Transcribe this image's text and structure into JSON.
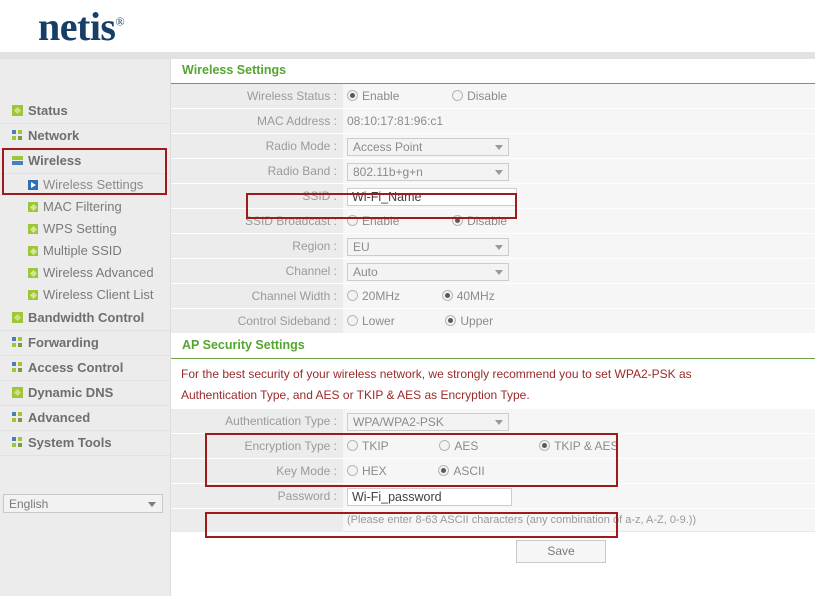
{
  "brand": {
    "name": "netis",
    "trademark": "®"
  },
  "sidebar": {
    "items": [
      {
        "label": "Status",
        "icon": "green-diamond-icon",
        "level": "top"
      },
      {
        "label": "Network",
        "icon": "grid-squares-icon",
        "level": "top"
      },
      {
        "label": "Wireless",
        "icon": "two-bars-icon",
        "level": "top"
      },
      {
        "label": "Wireless Settings",
        "icon": "play-arrow-icon",
        "level": "sub"
      },
      {
        "label": "MAC Filtering",
        "icon": "green-dot-icon",
        "level": "sub"
      },
      {
        "label": "WPS Setting",
        "icon": "green-dot-icon",
        "level": "sub"
      },
      {
        "label": "Multiple SSID",
        "icon": "green-dot-icon",
        "level": "sub"
      },
      {
        "label": "Wireless Advanced",
        "icon": "green-dot-icon",
        "level": "sub"
      },
      {
        "label": "Wireless Client List",
        "icon": "green-dot-icon",
        "level": "sub"
      },
      {
        "label": "Bandwidth Control",
        "icon": "green-diamond-icon",
        "level": "top"
      },
      {
        "label": "Forwarding",
        "icon": "grid-squares-icon",
        "level": "top"
      },
      {
        "label": "Access Control",
        "icon": "grid-squares-icon",
        "level": "top"
      },
      {
        "label": "Dynamic DNS",
        "icon": "green-diamond-icon",
        "level": "top"
      },
      {
        "label": "Advanced",
        "icon": "grid-squares-icon",
        "level": "top"
      },
      {
        "label": "System Tools",
        "icon": "grid-squares-icon",
        "level": "top"
      }
    ],
    "language": {
      "selected": "English",
      "icon": "chevron-down-icon"
    }
  },
  "main": {
    "wireless_section_title": "Wireless Settings",
    "security_section_title": "AP Security Settings",
    "rows": {
      "wireless_status": {
        "label": "Wireless Status :",
        "options": [
          {
            "label": "Enable",
            "selected": true
          },
          {
            "label": "Disable",
            "selected": false
          }
        ]
      },
      "mac_address": {
        "label": "MAC Address :",
        "value": "08:10:17:81:96:c1"
      },
      "radio_mode": {
        "label": "Radio Mode :",
        "value": "Access Point"
      },
      "radio_band": {
        "label": "Radio Band :",
        "value": "802.11b+g+n"
      },
      "ssid": {
        "label": "SSID :",
        "value": "Wi-Fi_Name"
      },
      "ssid_broadcast": {
        "label": "SSID Broadcast :",
        "options": [
          {
            "label": "Enable",
            "selected": false
          },
          {
            "label": "Disable",
            "selected": true
          }
        ]
      },
      "region": {
        "label": "Region :",
        "value": "EU"
      },
      "channel": {
        "label": "Channel :",
        "value": "Auto"
      },
      "channel_width": {
        "label": "Channel Width :",
        "options": [
          {
            "label": "20MHz",
            "selected": false
          },
          {
            "label": "40MHz",
            "selected": true
          }
        ]
      },
      "control_sideband": {
        "label": "Control Sideband :",
        "options": [
          {
            "label": "Lower",
            "selected": false
          },
          {
            "label": "Upper",
            "selected": true
          }
        ]
      },
      "auth_type": {
        "label": "Authentication Type :",
        "value": "WPA/WPA2-PSK"
      },
      "encryption_type": {
        "label": "Encryption Type :",
        "options": [
          {
            "label": "TKIP",
            "selected": false
          },
          {
            "label": "AES",
            "selected": false
          },
          {
            "label": "TKIP & AES",
            "selected": true
          }
        ]
      },
      "key_mode": {
        "label": "Key Mode :",
        "options": [
          {
            "label": "HEX",
            "selected": false
          },
          {
            "label": "ASCII",
            "selected": true
          }
        ]
      },
      "password": {
        "label": "Password :",
        "value": "Wi-Fi_password"
      }
    },
    "security_warning_line1": "For the best security of your wireless network, we strongly recommend you to set WPA2-PSK as",
    "security_warning_line2": "Authentication Type, and AES or TKIP & AES as Encryption Type.",
    "password_hint": "(Please enter 8-63 ASCII characters (any combination of a-z, A-Z, 0-9.))",
    "save_label": "Save"
  },
  "colors": {
    "brand_navy": "#173e66",
    "section_green": "#55a532",
    "highlight_red": "#9e1b1b",
    "warning_red": "#9a2a2a",
    "sidebar_bg": "#ececec"
  }
}
